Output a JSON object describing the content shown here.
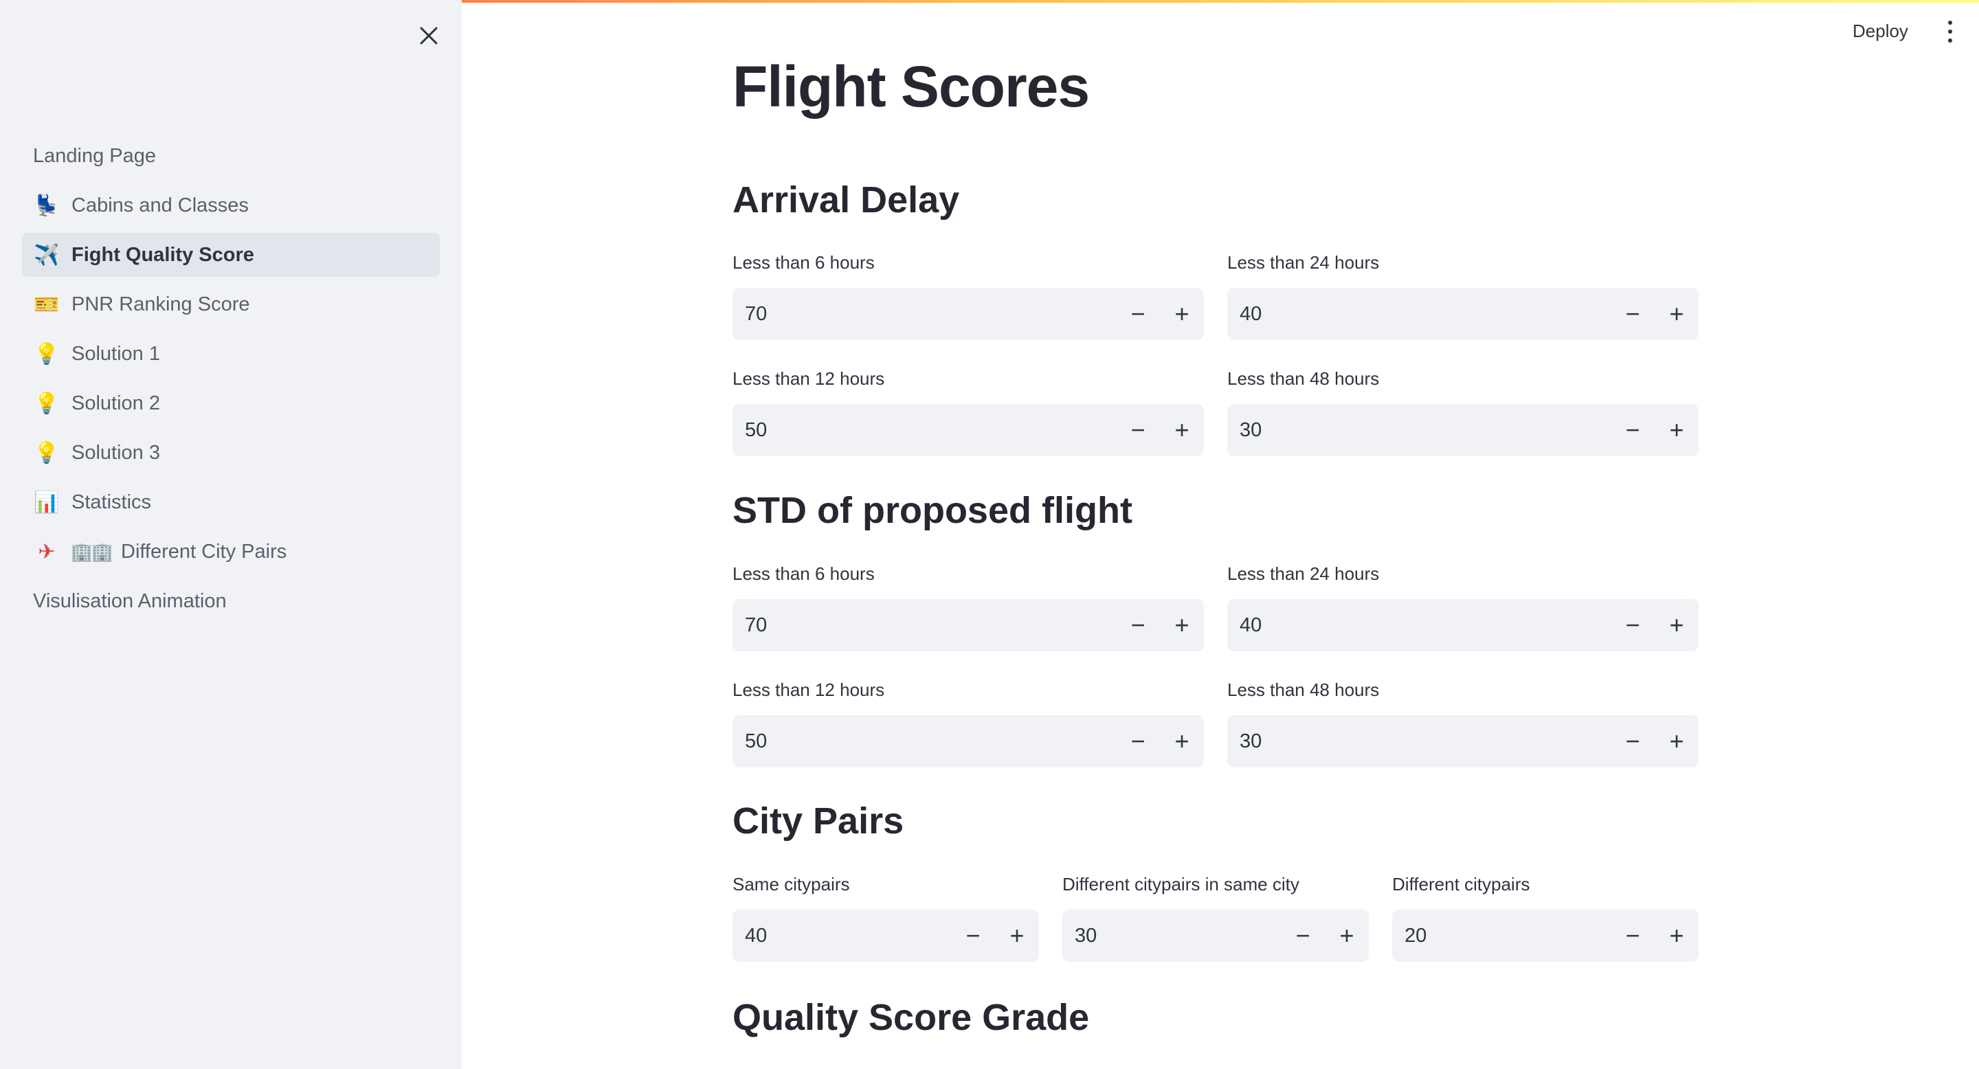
{
  "header": {
    "deploy_label": "Deploy"
  },
  "sidebar": {
    "items": [
      {
        "label": "Landing Page",
        "icon": "",
        "active": false
      },
      {
        "label": "Cabins and Classes",
        "icon": "seat-icon",
        "active": false
      },
      {
        "label": "Fight Quality Score",
        "icon": "airplane-icon",
        "active": true
      },
      {
        "label": "PNR Ranking Score",
        "icon": "ticket-icon",
        "active": false
      },
      {
        "label": "Solution 1",
        "icon": "lightbulb-icon",
        "active": false
      },
      {
        "label": "Solution 2",
        "icon": "lightbulb-icon",
        "active": false
      },
      {
        "label": "Solution 3",
        "icon": "lightbulb-icon",
        "active": false
      },
      {
        "label": "Statistics",
        "icon": "bar-chart-icon",
        "active": false
      },
      {
        "label": "Different City Pairs",
        "icon": "small-airplane-icon",
        "active": false
      },
      {
        "label": "Visulisation Animation",
        "icon": "",
        "active": false
      }
    ]
  },
  "main": {
    "title": "Flight Scores",
    "arrival_delay": {
      "title": "Arrival Delay",
      "fields": [
        {
          "label": "Less than 6 hours",
          "value": "70"
        },
        {
          "label": "Less than 24 hours",
          "value": "40"
        },
        {
          "label": "Less than 12 hours",
          "value": "50"
        },
        {
          "label": "Less than 48 hours",
          "value": "30"
        }
      ]
    },
    "std": {
      "title": "STD of proposed flight",
      "fields": [
        {
          "label": "Less than 6 hours",
          "value": "70"
        },
        {
          "label": "Less than 24 hours",
          "value": "40"
        },
        {
          "label": "Less than 12 hours",
          "value": "50"
        },
        {
          "label": "Less than 48 hours",
          "value": "30"
        }
      ]
    },
    "city_pairs": {
      "title": "City Pairs",
      "fields": [
        {
          "label": "Same citypairs",
          "value": "40"
        },
        {
          "label": "Different citypairs in same city",
          "value": "30"
        },
        {
          "label": "Different citypairs",
          "value": "20"
        }
      ]
    },
    "quality_grade": {
      "title": "Quality Score Grade"
    }
  },
  "stepper": {
    "minus": "−",
    "plus": "+"
  },
  "colors": {
    "sidebar_bg": "#f0f2f6",
    "input_bg": "#f0f2f6",
    "text": "#31333f",
    "accent_gradient_start": "#ff4b4b"
  }
}
